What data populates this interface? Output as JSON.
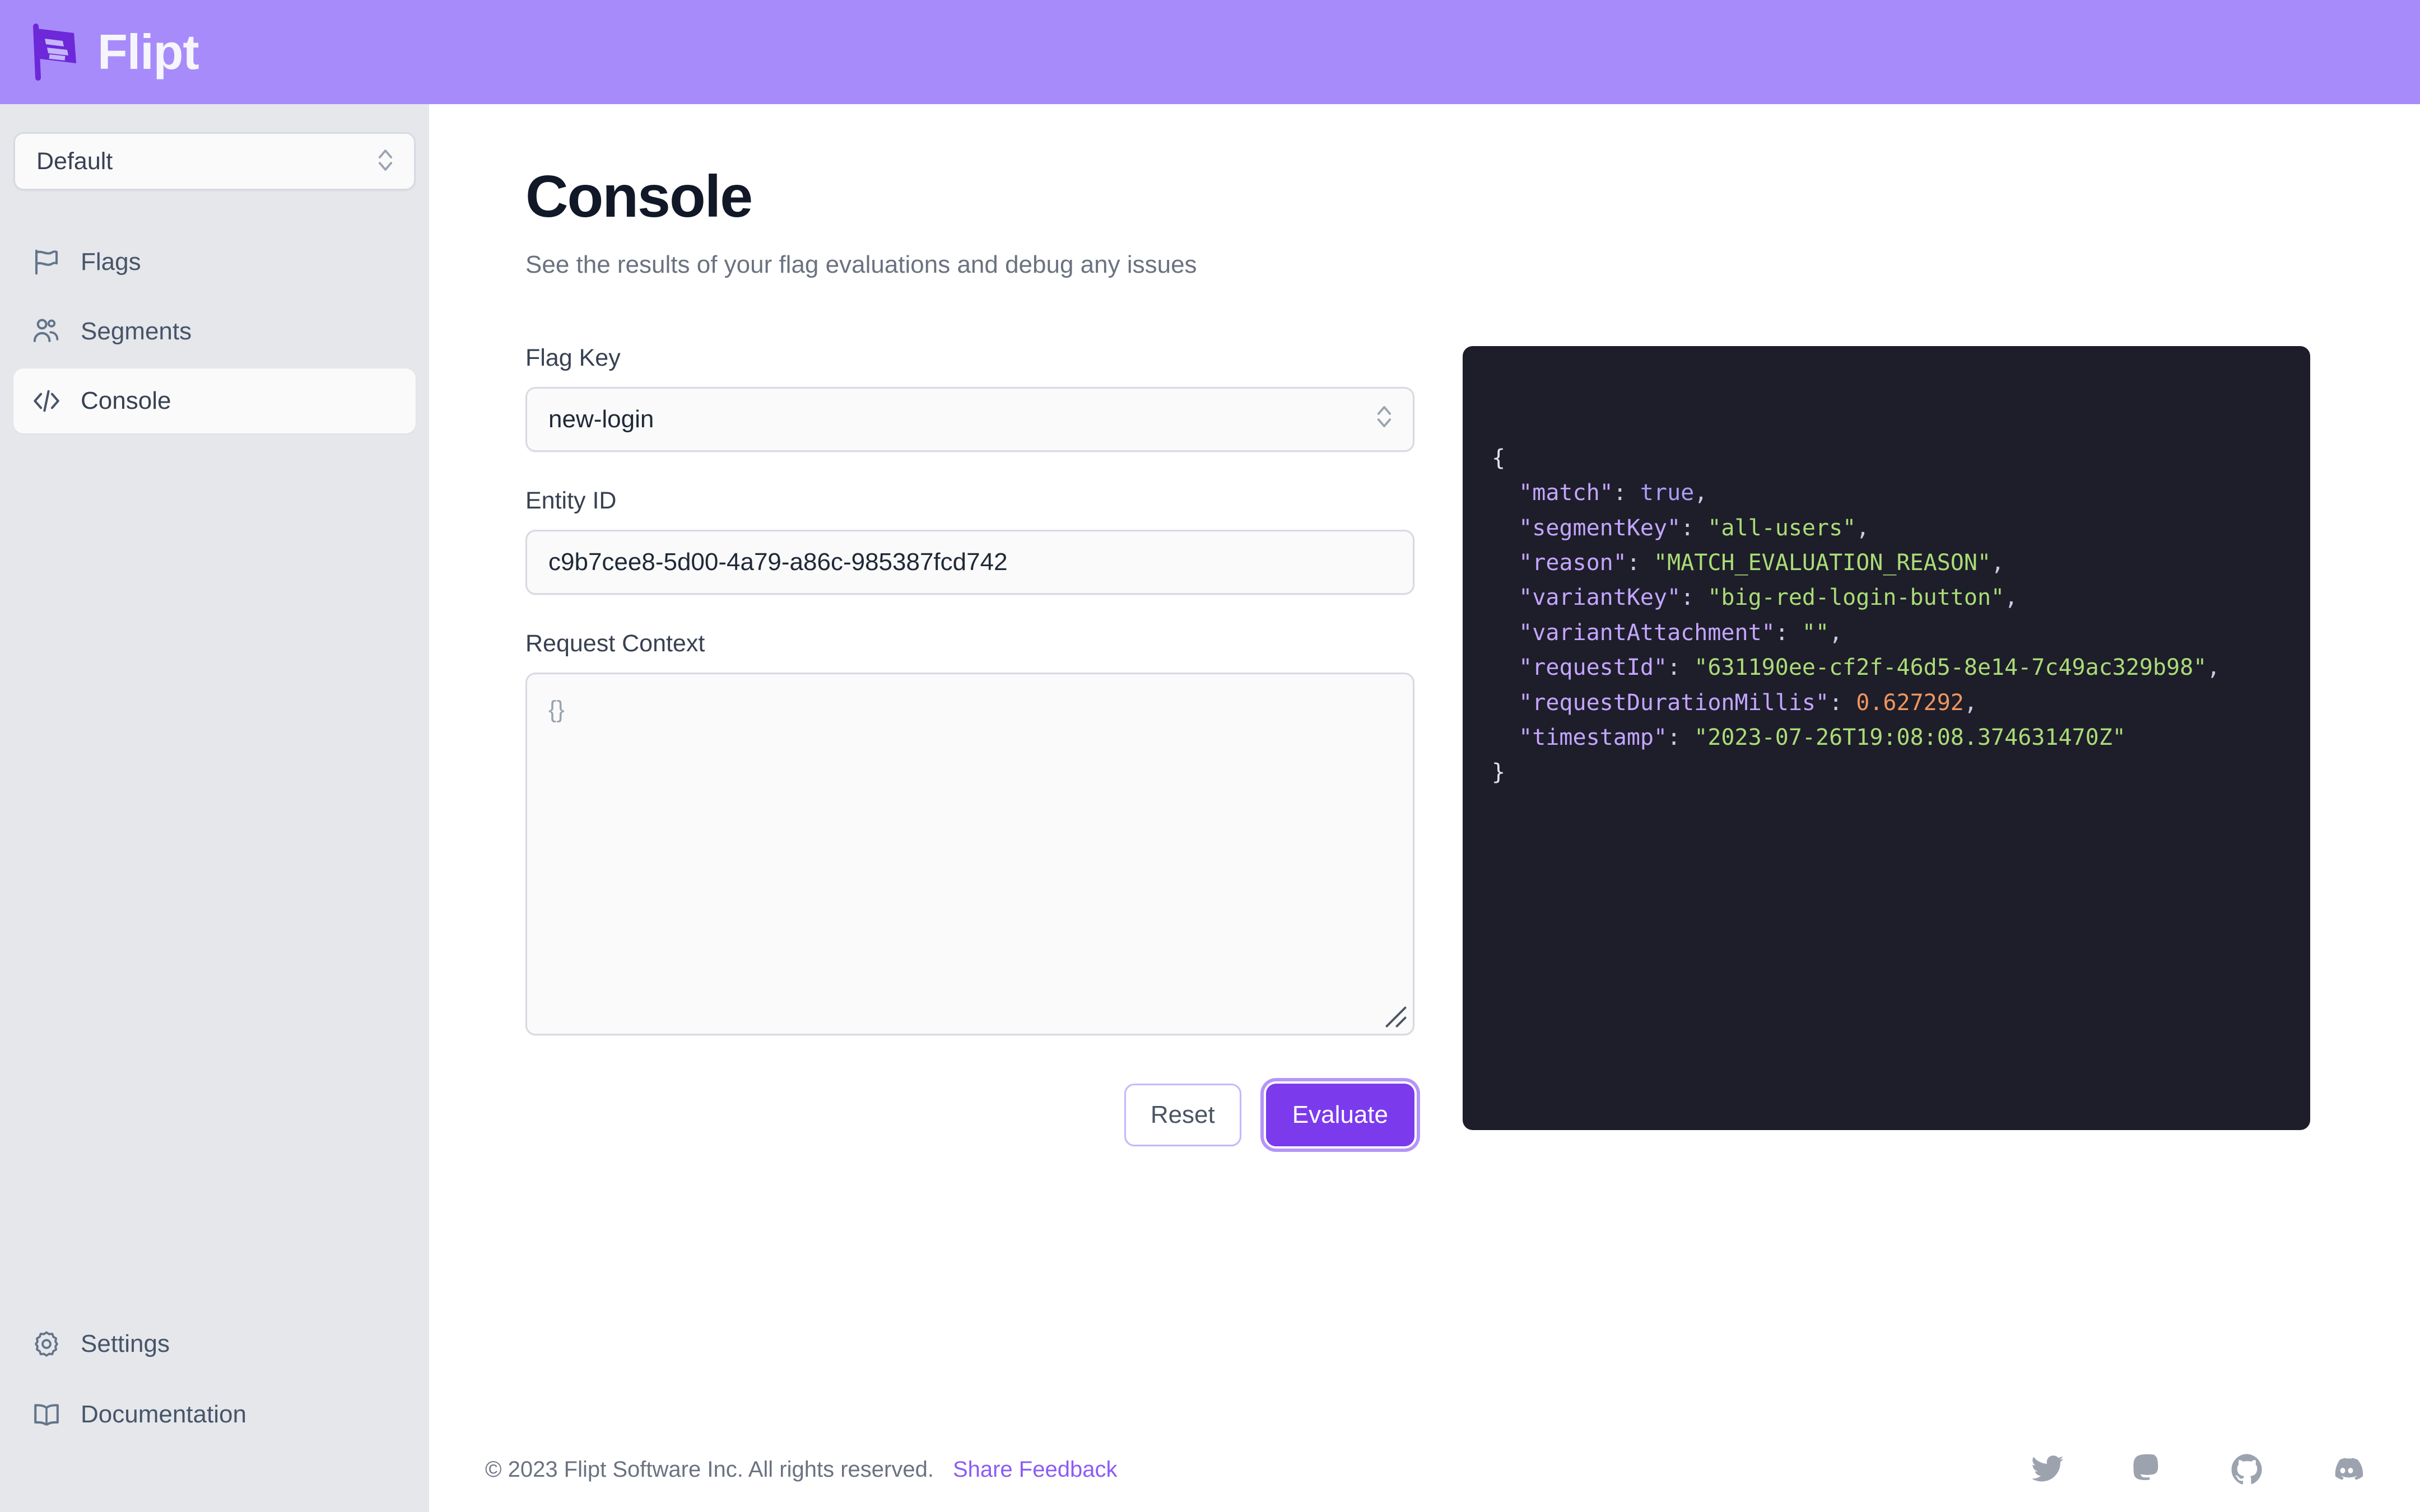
{
  "header": {
    "brand_name": "Flipt",
    "brand_icon": "flipt-flag-logo",
    "bg_color": "#a78bfa"
  },
  "sidebar": {
    "namespace_select": {
      "value": "Default",
      "icon": "chevron-up-down-icon"
    },
    "items": [
      {
        "label": "Flags",
        "icon": "flag-icon",
        "active": false
      },
      {
        "label": "Segments",
        "icon": "users-icon",
        "active": false
      },
      {
        "label": "Console",
        "icon": "code-brackets-icon",
        "active": true
      }
    ],
    "bottom_items": [
      {
        "label": "Settings",
        "icon": "gear-icon"
      },
      {
        "label": "Documentation",
        "icon": "book-open-icon"
      }
    ]
  },
  "main": {
    "title": "Console",
    "subtitle": "See the results of your flag evaluations and debug any issues",
    "form": {
      "flag_key": {
        "label": "Flag Key",
        "value": "new-login",
        "icon": "chevron-up-down-icon"
      },
      "entity_id": {
        "label": "Entity ID",
        "value": "c9b7cee8-5d00-4a79-a86c-985387fcd742"
      },
      "request_context": {
        "label": "Request Context",
        "value": "{}"
      },
      "reset_label": "Reset",
      "evaluate_label": "Evaluate",
      "primary_color": "#7c3aed"
    },
    "result": {
      "bg_color": "#1e1d2a",
      "open_brace": "{",
      "close_brace": "}",
      "lines": [
        {
          "key": "\"match\"",
          "sep": ": ",
          "value": "true",
          "kind": "bool",
          "comma": ","
        },
        {
          "key": "\"segmentKey\"",
          "sep": ": ",
          "value": "\"all-users\"",
          "kind": "str",
          "comma": ","
        },
        {
          "key": "\"reason\"",
          "sep": ": ",
          "value": "\"MATCH_EVALUATION_REASON\"",
          "kind": "str",
          "comma": ","
        },
        {
          "key": "\"variantKey\"",
          "sep": ": ",
          "value": "\"big-red-login-button\"",
          "kind": "str",
          "comma": ","
        },
        {
          "key": "\"variantAttachment\"",
          "sep": ": ",
          "value": "\"\"",
          "kind": "str",
          "comma": ","
        },
        {
          "key": "\"requestId\"",
          "sep": ": ",
          "value": "\"631190ee-cf2f-46d5-8e14-7c49ac329b98\"",
          "kind": "str",
          "comma": ","
        },
        {
          "key": "\"requestDurationMillis\"",
          "sep": ": ",
          "value": "0.627292",
          "kind": "num",
          "comma": ","
        },
        {
          "key": "\"timestamp\"",
          "sep": ": ",
          "value": "\"2023-07-26T19:08:08.374631470Z\"",
          "kind": "str",
          "comma": ""
        }
      ]
    }
  },
  "footer": {
    "copyright": "© 2023 Flipt Software Inc. All rights reserved.",
    "feedback_label": "Share Feedback",
    "socials": [
      {
        "name": "twitter-icon"
      },
      {
        "name": "mastodon-icon"
      },
      {
        "name": "github-icon"
      },
      {
        "name": "discord-icon"
      }
    ]
  }
}
